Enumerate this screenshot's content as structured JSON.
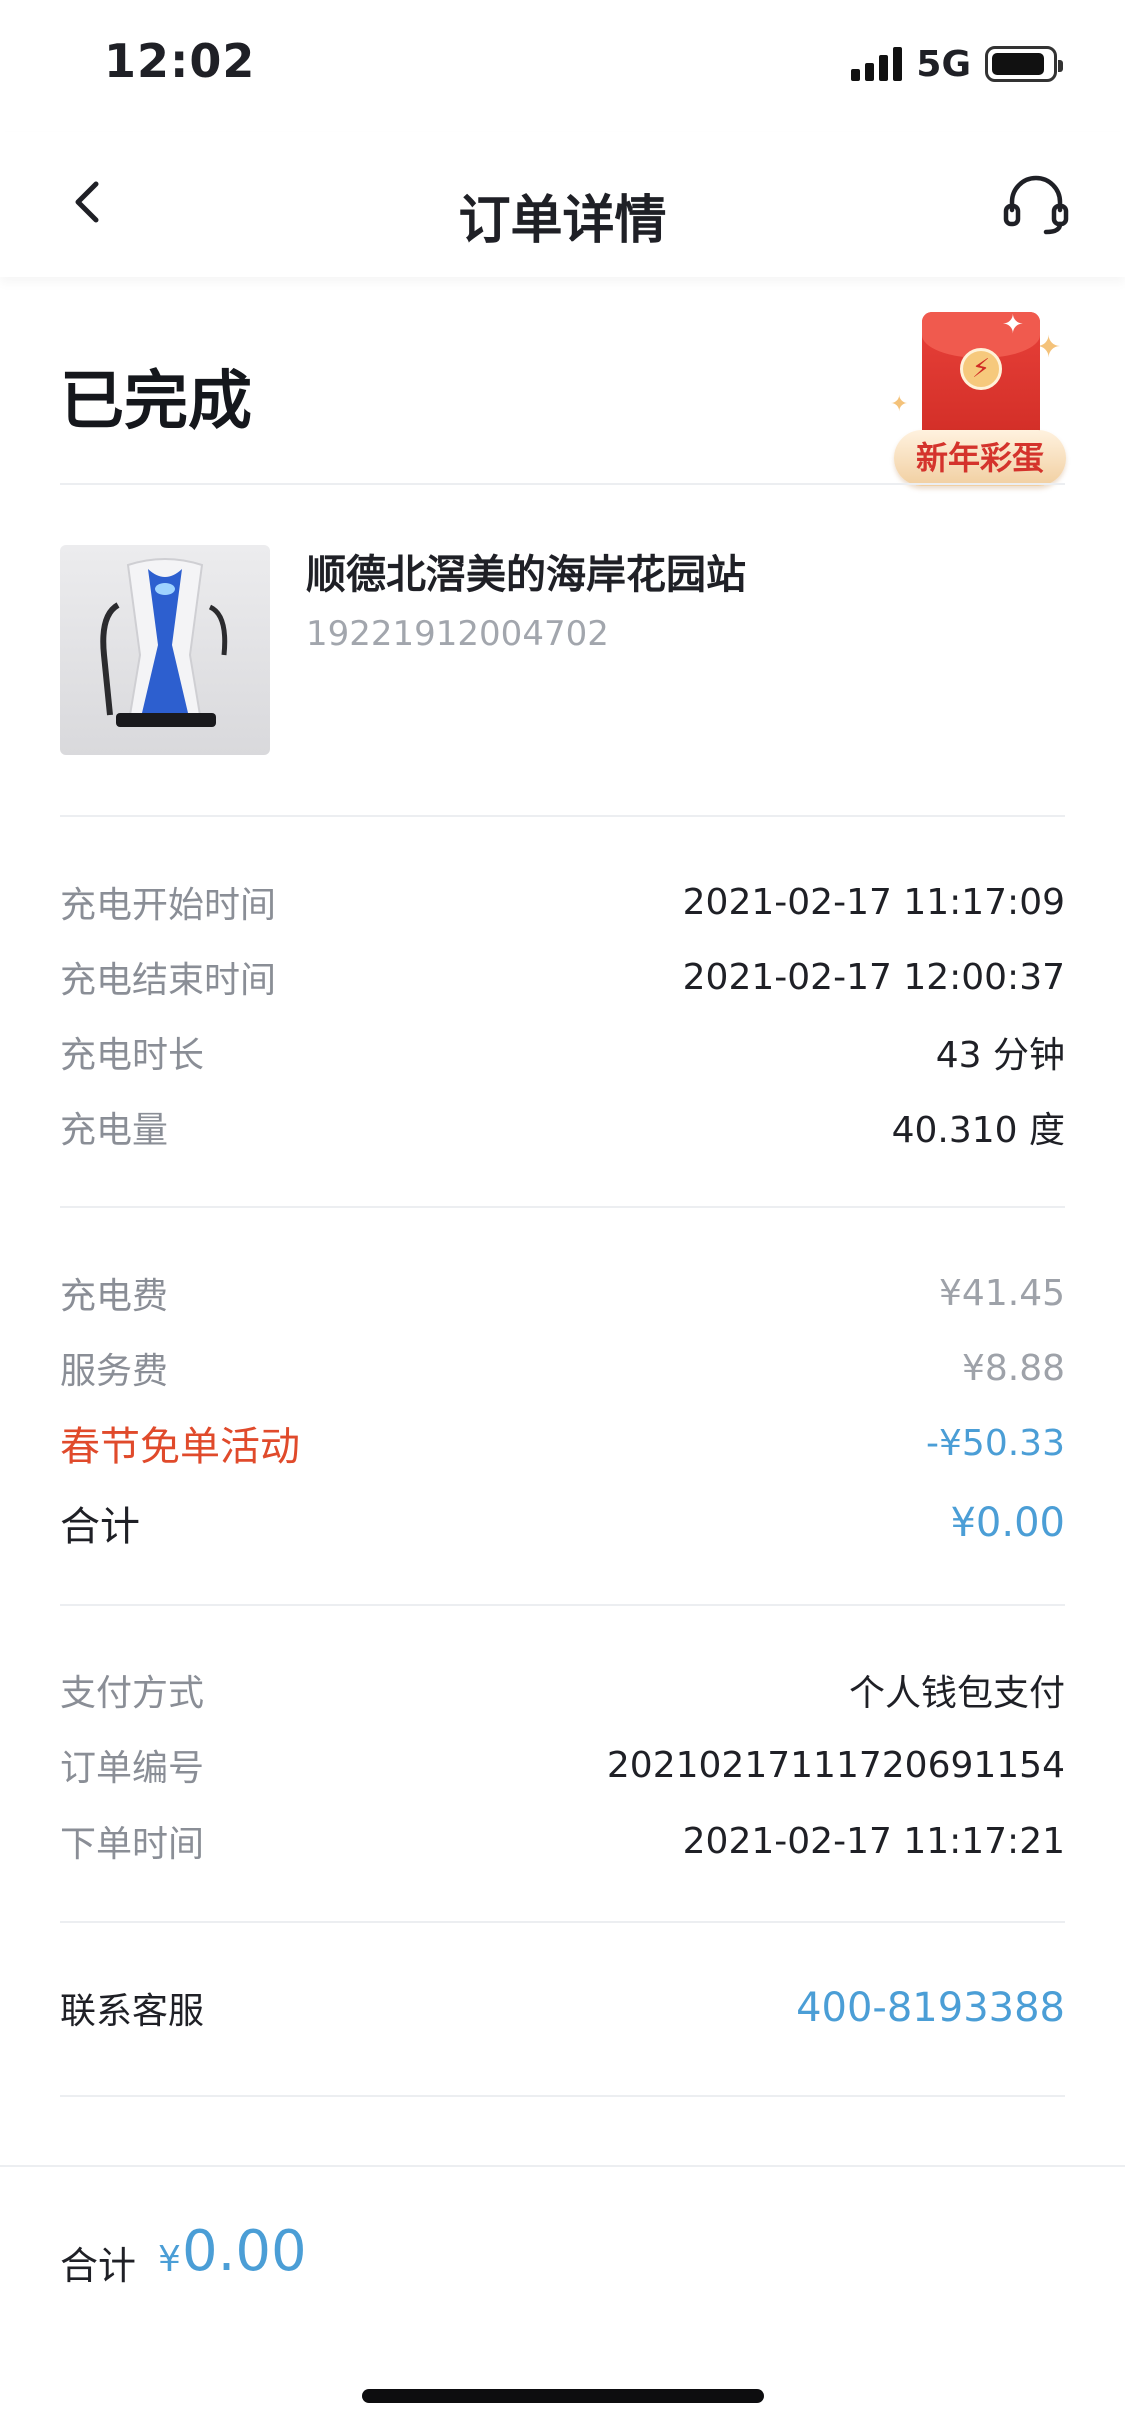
{
  "status_bar": {
    "time": "12:02",
    "network": "5G",
    "battery_level": 0.9
  },
  "nav": {
    "title": "订单详情",
    "back_icon": "chevron-left-icon",
    "support_icon": "headset-icon"
  },
  "order_status": "已完成",
  "promo": {
    "label": "新年彩蛋",
    "icon": "red-envelope-icon",
    "bolt": "⚡"
  },
  "station": {
    "name": "顺德北滘美的海岸花园站",
    "id": "19221912004702",
    "image": "charging-pile-image"
  },
  "charging": [
    {
      "label": "充电开始时间",
      "value": "2021-02-17 11:17:09"
    },
    {
      "label": "充电结束时间",
      "value": "2021-02-17 12:00:37"
    },
    {
      "label": "充电时长",
      "value": "43 分钟"
    },
    {
      "label": "充电量",
      "value": "40.310 度"
    }
  ],
  "fees": {
    "charge_fee": {
      "label": "充电费",
      "value": "¥41.45"
    },
    "service_fee": {
      "label": "服务费",
      "value": "¥8.88"
    },
    "promotion": {
      "label": "春节免单活动",
      "value": "-¥50.33"
    },
    "total": {
      "label": "合计",
      "value": "¥0.00"
    }
  },
  "payment": [
    {
      "label": "支付方式",
      "value": "个人钱包支付"
    },
    {
      "label": "订单编号",
      "value": "20210217111720691154"
    },
    {
      "label": "下单时间",
      "value": "2021-02-17 11:17:21"
    }
  ],
  "contact": {
    "label": "联系客服",
    "phone": "400-8193388"
  },
  "bottom": {
    "label": "合计",
    "currency": "¥",
    "amount": "0.00"
  },
  "colors": {
    "accent_blue": "#4b9ed6",
    "promo_red": "#e04a2b",
    "muted_gray": "#8a8e96"
  }
}
